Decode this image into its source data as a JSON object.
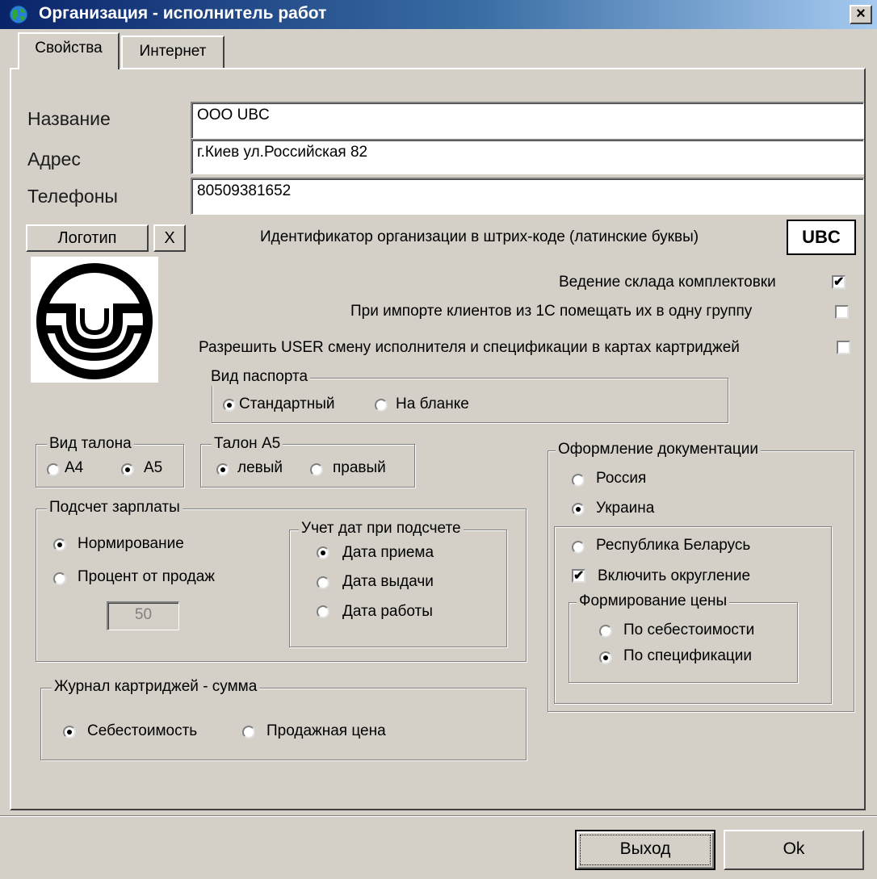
{
  "window": {
    "title": "Организация - исполнитель работ",
    "close_glyph": "×"
  },
  "tabs": [
    {
      "label": "Свойства",
      "active": true
    },
    {
      "label": "Интернет",
      "active": false
    }
  ],
  "fields": {
    "name": {
      "label": "Название",
      "value": "ООО UBC"
    },
    "address": {
      "label": "Адрес",
      "value": "г.Киев ул.Российская 82"
    },
    "phones": {
      "label": "Телефоны",
      "value": "80509381652"
    }
  },
  "logo": {
    "button_label": "Логотип",
    "clear_label": "X"
  },
  "barcode": {
    "label": "Идентификатор организации в штрих-коде (латинские буквы)",
    "value": "UBC"
  },
  "options": {
    "warehouse": {
      "label": "Ведение склада комплектовки",
      "checked": true
    },
    "import_1c": {
      "label": "При импорте клиентов из 1С помещать их в одну группу",
      "checked": false
    },
    "allow_user": {
      "label": "Разрешить USER смену исполнителя и спецификации в картах картриджей",
      "checked": false
    }
  },
  "passport": {
    "title": "Вид паспорта",
    "opt1": "Стандартный",
    "opt2": "На бланке",
    "selected": 1
  },
  "talon": {
    "title": "Вид талона",
    "opt1": "А4",
    "opt2": "А5",
    "selected": 2
  },
  "talon_a5": {
    "title": "Талон А5",
    "opt1": "левый",
    "opt2": "правый",
    "selected": 1
  },
  "salary": {
    "title": "Подсчет зарплаты",
    "opt1": "Нормирование",
    "opt2": "Процент от продаж",
    "selected": 1,
    "percent_value": "50",
    "dates": {
      "title": "Учет дат при подсчете",
      "opt1": "Дата приема",
      "opt2": "Дата выдачи",
      "opt3": "Дата работы",
      "selected": 1
    }
  },
  "journal": {
    "title": "Журнал картриджей - сумма",
    "opt1": "Себестоимость",
    "opt2": "Продажная цена",
    "selected": 1
  },
  "docs": {
    "title": "Оформление документации",
    "opt1": "Россия",
    "opt2": "Украина",
    "opt3": "Республика Беларусь",
    "selected": 2,
    "rounding": {
      "label": "Включить округление",
      "checked": true
    },
    "price": {
      "title": "Формирование цены",
      "opt1": "По себестоимости",
      "opt2": "По спецификации",
      "selected": 2
    }
  },
  "footer": {
    "exit_label": "Выход",
    "ok_label": "Ok"
  },
  "icons": {
    "app": "globe-icon",
    "check": "checkmark-icon"
  }
}
